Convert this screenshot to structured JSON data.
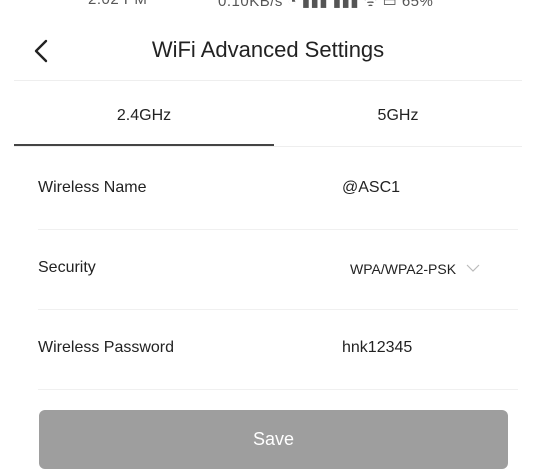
{
  "status_bar": {
    "left_text": "2:02 PM",
    "right_text": "0.10KB/s ◔ ▮▮▮ ▮▮▮ ᯤ ▭ 65%"
  },
  "nav": {
    "title": "WiFi Advanced Settings",
    "back_icon": "chevron-left-icon"
  },
  "tabs": [
    {
      "label": "2.4GHz",
      "active": true
    },
    {
      "label": "5GHz",
      "active": false
    }
  ],
  "settings": {
    "wireless_name": {
      "label": "Wireless Name",
      "value": "@ASC1"
    },
    "security": {
      "label": "Security",
      "value": "WPA/WPA2-PSK",
      "icon": "chevron-down-icon"
    },
    "wireless_password": {
      "label": "Wireless Password",
      "value": "hnk12345"
    }
  },
  "save_button": {
    "label": "Save",
    "color": "#9e9e9e"
  }
}
